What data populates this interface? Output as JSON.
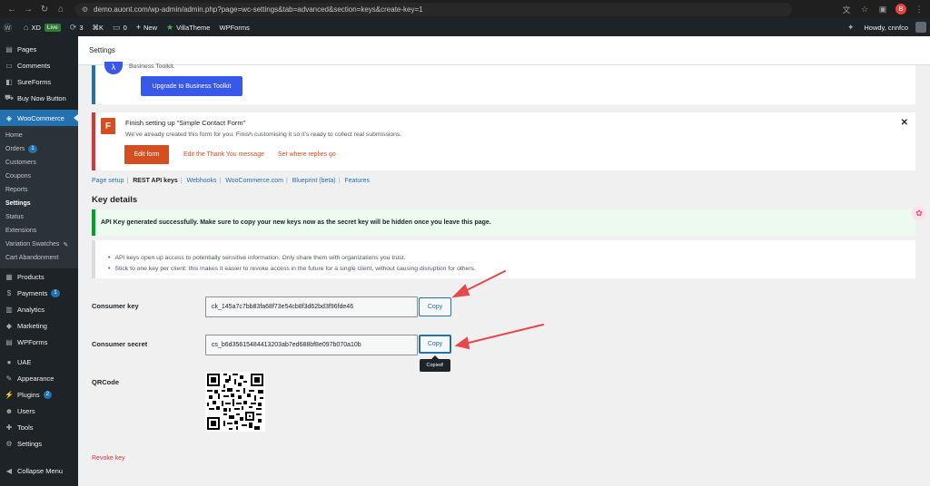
{
  "browser": {
    "url": "demo.auont.com/wp-admin/admin.php?page=wc-settings&tab=advanced&section=keys&create-key=1",
    "profile_initial": "B"
  },
  "admin_bar": {
    "site_name": "XD",
    "live_label": "Live",
    "updates_count": "3",
    "shortcut_label": "⌘K",
    "comments_count": "0",
    "new_label": "New",
    "villatheme_label": "VillaTheme",
    "wpforms_label": "WPForms",
    "howdy": "Howdy, cnnfco"
  },
  "sidebar": {
    "items_top": [
      {
        "label": "Pages",
        "icon": "pages-icon"
      },
      {
        "label": "Comments",
        "icon": "comments-icon"
      },
      {
        "label": "SureForms",
        "icon": "sureforms-icon"
      },
      {
        "label": "Buy Now Button",
        "icon": "cart-icon"
      }
    ],
    "woocommerce_label": "WooCommerce",
    "woo_sub": [
      {
        "label": "Home"
      },
      {
        "label": "Orders",
        "count": "1"
      },
      {
        "label": "Customers"
      },
      {
        "label": "Coupons"
      },
      {
        "label": "Reports"
      },
      {
        "label": "Settings"
      },
      {
        "label": "Status"
      },
      {
        "label": "Extensions"
      },
      {
        "label": "Variation Swatches"
      },
      {
        "label": "Cart Abandonment"
      }
    ],
    "items_bottom": [
      {
        "label": "Products",
        "icon": "products-icon"
      },
      {
        "label": "Payments",
        "icon": "payments-icon",
        "count": "1"
      },
      {
        "label": "Analytics",
        "icon": "analytics-icon"
      },
      {
        "label": "Marketing",
        "icon": "marketing-icon"
      },
      {
        "label": "WPForms",
        "icon": "wpforms-icon"
      }
    ],
    "items_bottom2": [
      {
        "label": "UAE",
        "icon": "uae-icon"
      },
      {
        "label": "Appearance",
        "icon": "appearance-icon"
      },
      {
        "label": "Plugins",
        "icon": "plugins-icon",
        "count": "2"
      },
      {
        "label": "Users",
        "icon": "users-icon"
      },
      {
        "label": "Tools",
        "icon": "tools-icon"
      },
      {
        "label": "Settings",
        "icon": "settings-icon"
      }
    ],
    "collapse_label": "Collapse Menu"
  },
  "page": {
    "header_title": "Settings",
    "bt_notice_text": "Business Toolkit.",
    "bt_button": "Upgrade to Business Toolkit",
    "form_notice": {
      "title": "Finish setting up “Simple Contact Form”",
      "desc": "We’ve already created this form for you. Finish customising it so it’s ready to collect real submissions.",
      "edit_button": "Edit form",
      "link1": "Edit the Thank You message",
      "link2": "Set where replies go"
    },
    "tabs": [
      "Page setup",
      "REST API keys",
      "Webhooks",
      "WooCommerce.com",
      "Blueprint (beta)",
      "Features"
    ],
    "key_details_title": "Key details",
    "success_message": "API Key generated successfully. Make sure to copy your new keys now as the secret key will be hidden once you leave this page.",
    "info_items": [
      "API keys open up access to potentially sensitive information. Only share them with organizations you trust.",
      "Stick to one key per client: this makes it easier to revoke access in the future for a single client, without causing disruption for others."
    ],
    "consumer_key_label": "Consumer key",
    "consumer_key_value": "ck_145a7c7bb83fa68f73e54cb8f3d62bd3f96fde46",
    "consumer_secret_label": "Consumer secret",
    "consumer_secret_value": "cs_b6d35615484413203ab7ed688bf8e097b070a10b",
    "copy_label": "Copy",
    "copied_tooltip": "Copied!",
    "qrcode_label": "QRCode",
    "revoke_label": "Revoke key"
  },
  "colors": {
    "wp_blue": "#2271b1",
    "woo_orange": "#d54e21",
    "success_green": "#00a32a",
    "annotation_red": "#e6484b"
  }
}
